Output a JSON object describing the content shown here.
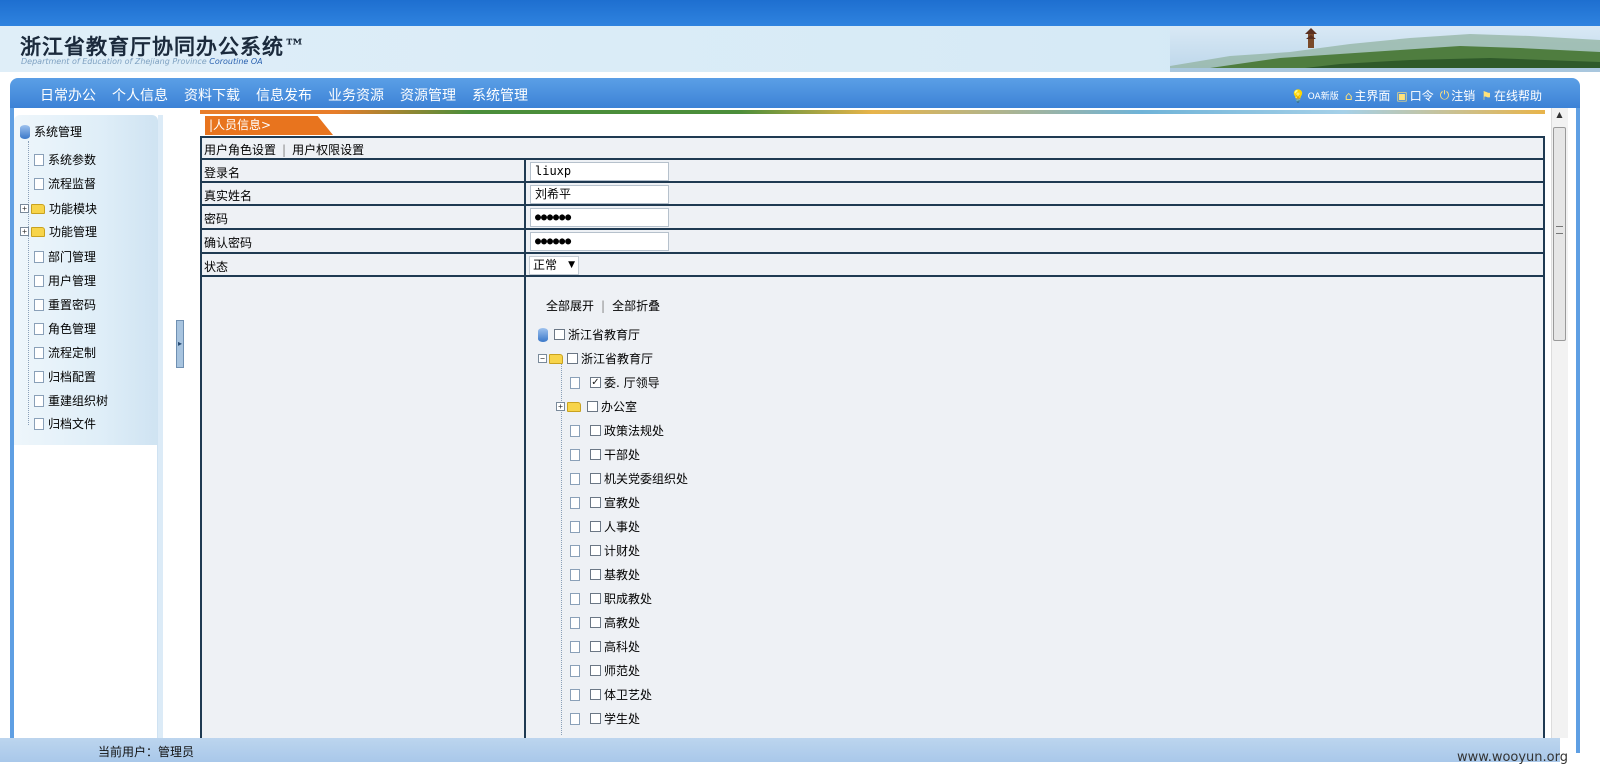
{
  "banner": {
    "title": "浙江省教育厅协同办公系统™",
    "subtitle": "Department of Education of Zhejiang Province",
    "subtitle_brand": "Coroutine OA"
  },
  "nav": {
    "items": [
      "日常办公",
      "个人信息",
      "资料下载",
      "信息发布",
      "业务资源",
      "资源管理",
      "系统管理"
    ],
    "tools": [
      "OA新版",
      "主界面",
      "口令",
      "注销",
      "在线帮助"
    ]
  },
  "sidebar": {
    "root": "系统管理",
    "items": [
      "系统参数",
      "流程监督",
      "功能模块",
      "功能管理",
      "部门管理",
      "用户管理",
      "重置密码",
      "角色管理",
      "流程定制",
      "归档配置",
      "重建组织树",
      "归档文件"
    ]
  },
  "tab": {
    "label": "|人员信息>"
  },
  "form": {
    "subtabs": [
      "用户角色设置",
      "用户权限设置"
    ],
    "login_label": "登录名",
    "login_value": "liuxp",
    "realname_label": "真实姓名",
    "realname_value": "刘希平",
    "password_label": "密码",
    "password_value": "●●●●●●",
    "confirm_label": "确认密码",
    "confirm_value": "●●●●●●",
    "status_label": "状态",
    "status_value": "正常"
  },
  "org_tree": {
    "expand_all": "全部展开",
    "collapse_all": "全部折叠",
    "root": "浙江省教育厅",
    "group": "浙江省教育厅",
    "children": [
      {
        "label": "委. 厅领导",
        "checked": true
      },
      {
        "label": "办公室",
        "checked": false
      },
      {
        "label": "政策法规处",
        "checked": false
      },
      {
        "label": "干部处",
        "checked": false
      },
      {
        "label": "机关党委组织处",
        "checked": false
      },
      {
        "label": "宣教处",
        "checked": false
      },
      {
        "label": "人事处",
        "checked": false
      },
      {
        "label": "计财处",
        "checked": false
      },
      {
        "label": "基教处",
        "checked": false
      },
      {
        "label": "职成教处",
        "checked": false
      },
      {
        "label": "高教处",
        "checked": false
      },
      {
        "label": "高科处",
        "checked": false
      },
      {
        "label": "师范处",
        "checked": false
      },
      {
        "label": "体卫艺处",
        "checked": false
      },
      {
        "label": "学生处",
        "checked": false
      }
    ]
  },
  "status": {
    "text": "当前用户：管理员"
  },
  "watermark": "www.wooyun.org",
  "colors": {
    "nav_blue": "#3c82d6",
    "tab_orange": "#e8741e",
    "border_dark": "#1f3a52"
  }
}
